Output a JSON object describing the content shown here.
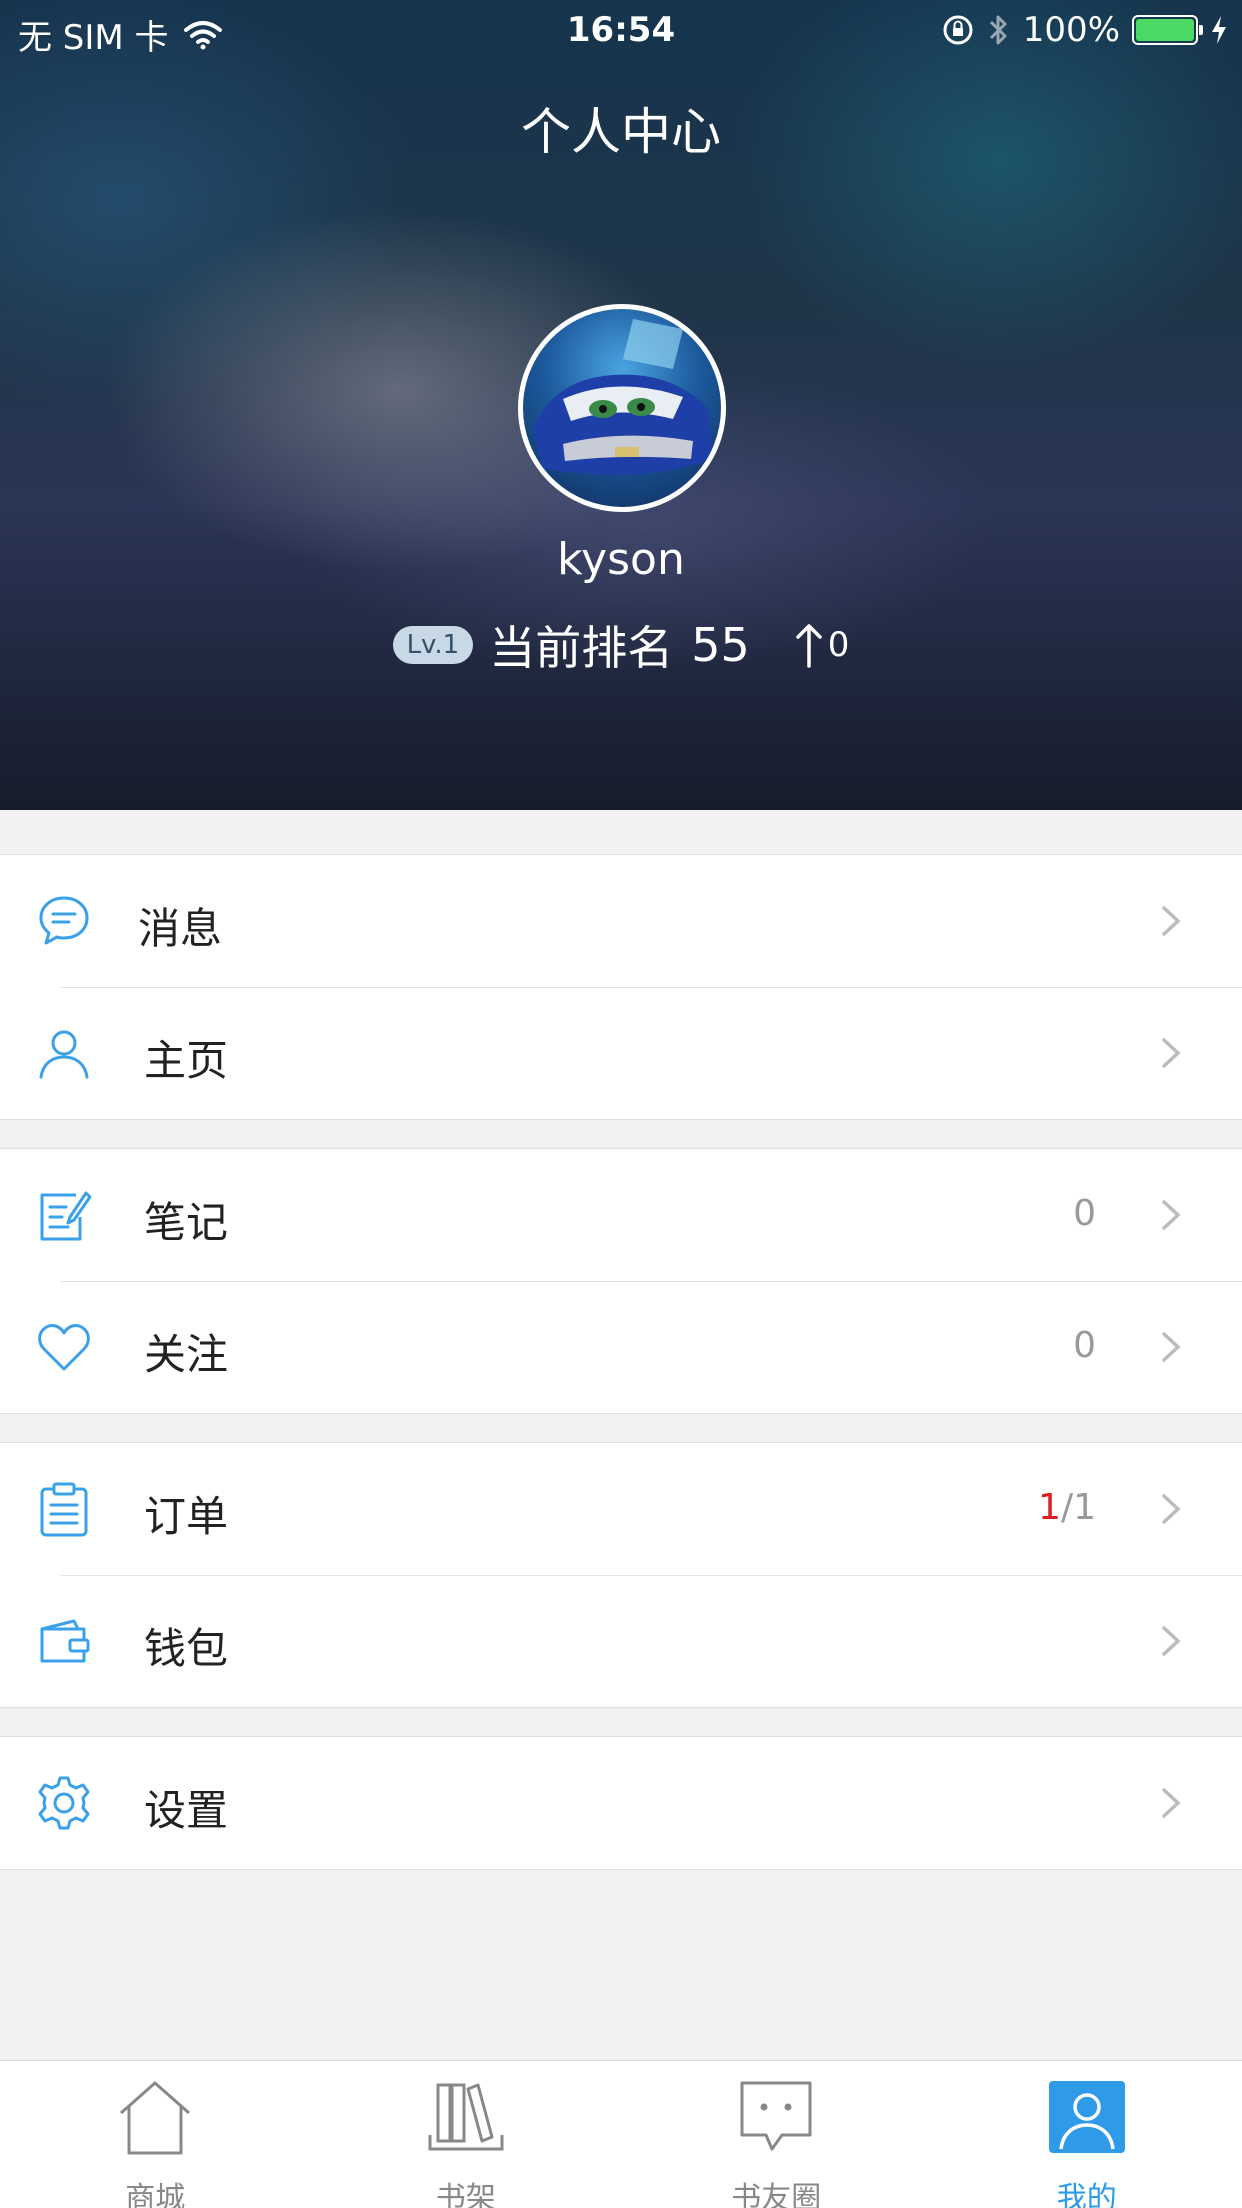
{
  "status_bar": {
    "carrier": "无 SIM 卡",
    "time": "16:54",
    "battery": "100%"
  },
  "header": {
    "title": "个人中心",
    "username": "kyson",
    "level_badge": "Lv.1",
    "rank_label": "当前排名",
    "rank_value": "55",
    "rank_change": "0"
  },
  "menu": {
    "group1": [
      {
        "label": "消息",
        "icon": "message-bubble-icon"
      },
      {
        "label": "主页",
        "icon": "person-icon"
      }
    ],
    "group2": [
      {
        "label": "笔记",
        "value": "0",
        "icon": "note-edit-icon"
      },
      {
        "label": "关注",
        "value": "0",
        "icon": "heart-icon"
      }
    ],
    "group3": [
      {
        "label": "订单",
        "value_highlight": "1",
        "value_rest": "/1",
        "icon": "clipboard-icon"
      },
      {
        "label": "钱包",
        "icon": "wallet-icon"
      }
    ],
    "group4": [
      {
        "label": "设置",
        "icon": "gear-icon"
      }
    ]
  },
  "tabbar": {
    "tabs": [
      {
        "label": "商城",
        "icon": "home-icon"
      },
      {
        "label": "书架",
        "icon": "bookshelf-icon"
      },
      {
        "label": "书友圈",
        "icon": "chat-bubble-icon"
      },
      {
        "label": "我的",
        "icon": "profile-icon"
      }
    ],
    "active_index": 3
  },
  "colors": {
    "accent": "#2e9ae8",
    "icon_blue": "#3aa0ea",
    "highlight_red": "#e02020",
    "battery_green": "#4cd964"
  }
}
